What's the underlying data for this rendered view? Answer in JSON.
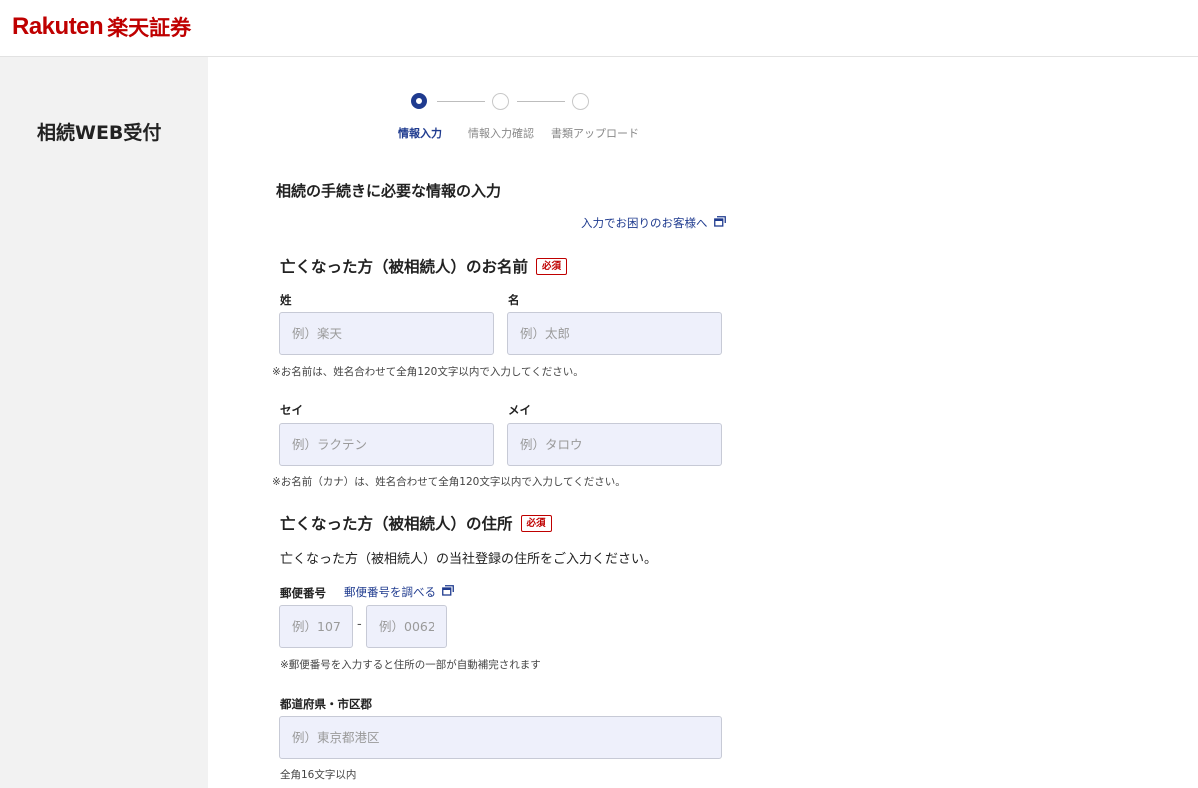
{
  "header": {
    "logo_en": "Rakuten",
    "logo_jp": "楽天証券"
  },
  "sidebar": {
    "title": "相続WEB受付"
  },
  "stepper": {
    "steps": [
      {
        "label": "情報入力",
        "active": true
      },
      {
        "label": "情報入力確認",
        "active": false
      },
      {
        "label": "書類アップロード",
        "active": false
      }
    ]
  },
  "main": {
    "heading": "相続の手続きに必要な情報の入力",
    "help_link": "入力でお困りのお客様へ"
  },
  "name_section": {
    "heading": "亡くなった方（被相続人）のお名前",
    "required": "必須",
    "last_name_label": "姓",
    "last_name_placeholder": "例）楽天",
    "first_name_label": "名",
    "first_name_placeholder": "例）太郎",
    "name_note": "※お名前は、姓名合わせて全角120文字以内で入力してください。",
    "last_kana_label": "セイ",
    "last_kana_placeholder": "例）ラクテン",
    "first_kana_label": "メイ",
    "first_kana_placeholder": "例）タロウ",
    "kana_note": "※お名前（カナ）は、姓名合わせて全角120文字以内で入力してください。"
  },
  "address_section": {
    "heading": "亡くなった方（被相続人）の住所",
    "required": "必須",
    "description": "亡くなった方（被相続人）の当社登録の住所をご入力ください。",
    "postal_label": "郵便番号",
    "postal_lookup_link": "郵便番号を調べる",
    "postal1_placeholder": "例）107",
    "postal_separator": "-",
    "postal2_placeholder": "例）0062",
    "postal_note": "※郵便番号を入力すると住所の一部が自動補完されます",
    "prefecture_label": "都道府県・市区郡",
    "prefecture_placeholder": "例）東京都港区",
    "prefecture_note": "全角16文字以内"
  },
  "colors": {
    "brand": "#bf0000",
    "accent": "#1f3b8f",
    "input_bg": "#eef0fb",
    "sidebar_bg": "#f2f2f2"
  }
}
